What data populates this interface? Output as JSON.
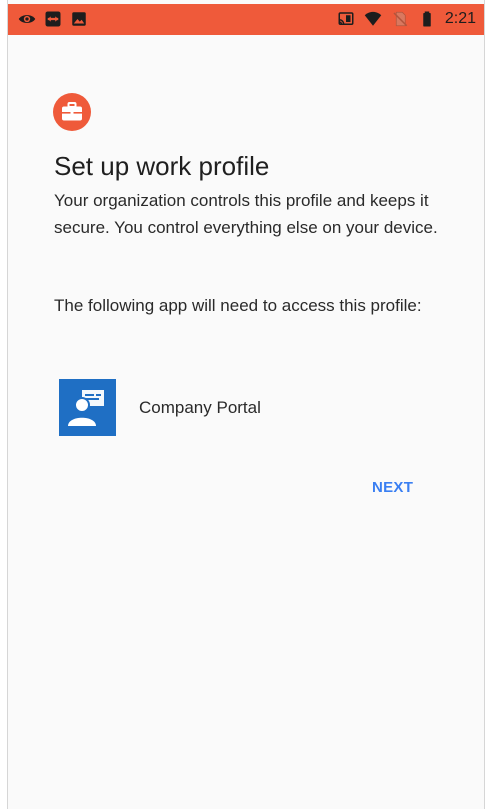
{
  "status_bar": {
    "time": "2:21",
    "background_color": "#ef5a3a",
    "left_icons": [
      "eye-icon",
      "teamviewer-icon",
      "image-icon"
    ],
    "right_icons": [
      "cast-icon",
      "wifi-icon",
      "no-sim-icon",
      "battery-icon"
    ]
  },
  "setup": {
    "logo_icon": "briefcase-icon",
    "title": "Set up work profile",
    "description": "Your organization controls this profile and keeps it secure. You control everything else on your device.",
    "access_text": "The following app will need to access this profile:",
    "apps": [
      {
        "name": "Company Portal",
        "icon": "company-portal-icon"
      }
    ],
    "next_label": "NEXT"
  },
  "colors": {
    "accent": "#ef5a3a",
    "link": "#3a7ff2",
    "app_icon_blue": "#1f6fc4"
  }
}
